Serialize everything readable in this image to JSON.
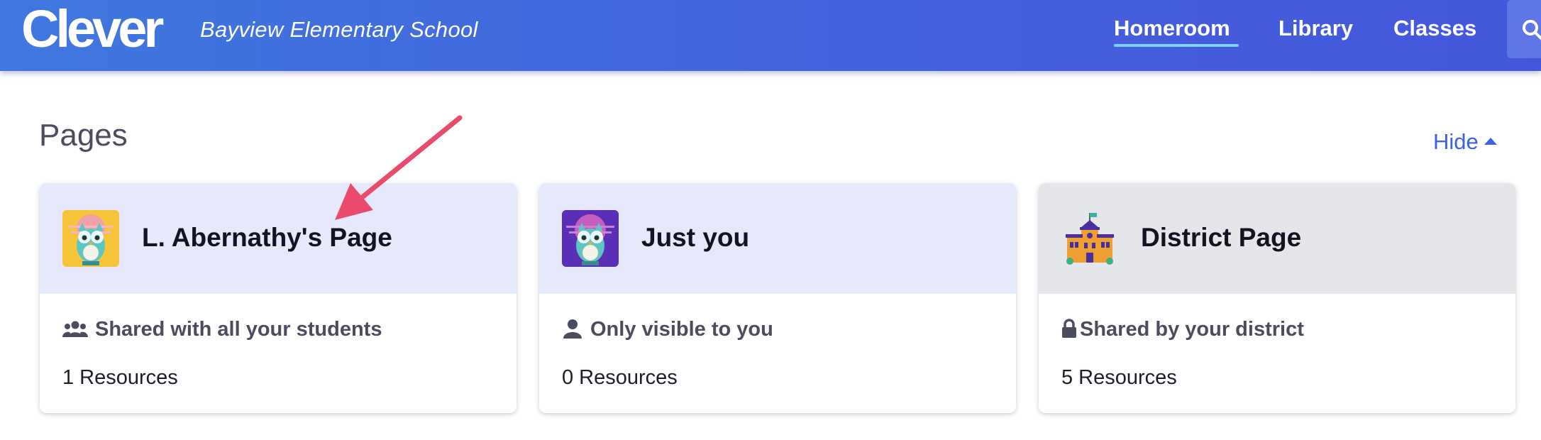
{
  "header": {
    "logo": "Clever",
    "school_name": "Bayview Elementary School",
    "nav": [
      {
        "label": "Homeroom",
        "active": true
      },
      {
        "label": "Library",
        "active": false
      },
      {
        "label": "Classes",
        "active": false
      }
    ],
    "search_icon": "search-icon"
  },
  "section": {
    "title": "Pages",
    "toggle_label": "Hide"
  },
  "cards": [
    {
      "title": "L. Abernathy's Page",
      "icon": "owl-icon-yellow",
      "meta_icon": "group-icon",
      "meta": "Shared with all your students",
      "count": "1 Resources"
    },
    {
      "title": "Just you",
      "icon": "owl-icon-purple",
      "meta_icon": "person-icon",
      "meta": "Only visible to you",
      "count": "0 Resources"
    },
    {
      "title": "District Page",
      "icon": "school-building-icon",
      "meta_icon": "lock-icon",
      "meta": "Shared by your district",
      "count": "5 Resources"
    }
  ],
  "colors": {
    "header_start": "#3f78de",
    "header_end": "#4457db",
    "accent": "#3e61e0",
    "nav_underline": "#7fd0f0",
    "card_head": "#e6e9fb",
    "district_head": "#e5e6e9",
    "annotation_arrow": "#ea4a6c"
  }
}
